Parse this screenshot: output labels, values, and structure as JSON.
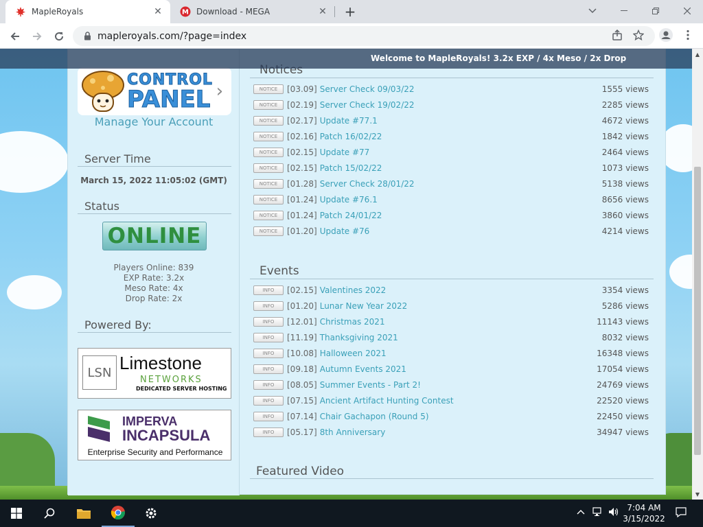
{
  "browser": {
    "tabs": [
      {
        "title": "MapleRoyals",
        "favicon": "maple-leaf-icon",
        "active": true
      },
      {
        "title": "Download - MEGA",
        "favicon": "mega-icon",
        "active": false
      }
    ],
    "url": "mapleroyals.com/?page=index"
  },
  "page": {
    "welcome": "Welcome to MapleRoyals! 3.2x EXP / 4x Meso / 2x Drop",
    "sidebar": {
      "cp_line1": "CONTROL",
      "cp_line2": "PANEL",
      "manage": "Manage Your Account",
      "server_time_heading": "Server Time",
      "server_time": "March 15, 2022 11:05:02 (GMT)",
      "status_heading": "Status",
      "status": "ONLINE",
      "players_online": "Players Online: 839",
      "exp_rate": "EXP Rate: 3.2x",
      "meso_rate": "Meso Rate: 4x",
      "drop_rate": "Drop Rate: 2x",
      "powered_heading": "Powered By:",
      "limestone": {
        "box": "LSN",
        "name": "Limestone",
        "sub": "NETWORKS",
        "tag": "DEDICATED SERVER HOSTING"
      },
      "imperva": {
        "name": "IMPERVA",
        "sub": "INCAPSULA",
        "tag": "Enterprise Security and Performance"
      }
    },
    "notices_heading": "Notices",
    "notices": [
      {
        "badge": "NOTICE",
        "date": "[03.09]",
        "title": "Server Check 09/03/22",
        "views": "1555 views"
      },
      {
        "badge": "NOTICE",
        "date": "[02.19]",
        "title": "Server Check 19/02/22",
        "views": "2285 views"
      },
      {
        "badge": "NOTICE",
        "date": "[02.17]",
        "title": "Update #77.1",
        "views": "4672 views"
      },
      {
        "badge": "NOTICE",
        "date": "[02.16]",
        "title": "Patch 16/02/22",
        "views": "1842 views"
      },
      {
        "badge": "NOTICE",
        "date": "[02.15]",
        "title": "Update #77",
        "views": "2464 views"
      },
      {
        "badge": "NOTICE",
        "date": "[02.15]",
        "title": "Patch 15/02/22",
        "views": "1073 views"
      },
      {
        "badge": "NOTICE",
        "date": "[01.28]",
        "title": "Server Check 28/01/22",
        "views": "5138 views"
      },
      {
        "badge": "NOTICE",
        "date": "[01.24]",
        "title": "Update #76.1",
        "views": "8656 views"
      },
      {
        "badge": "NOTICE",
        "date": "[01.24]",
        "title": "Patch 24/01/22",
        "views": "3860 views"
      },
      {
        "badge": "NOTICE",
        "date": "[01.20]",
        "title": "Update #76",
        "views": "4214 views"
      }
    ],
    "events_heading": "Events",
    "events": [
      {
        "badge": "INFO",
        "date": "[02.15]",
        "title": "Valentines 2022",
        "views": "3354 views"
      },
      {
        "badge": "INFO",
        "date": "[01.20]",
        "title": "Lunar New Year 2022",
        "views": "5286 views"
      },
      {
        "badge": "INFO",
        "date": "[12.01]",
        "title": "Christmas 2021",
        "views": "11143 views"
      },
      {
        "badge": "INFO",
        "date": "[11.19]",
        "title": "Thanksgiving 2021",
        "views": "8032 views"
      },
      {
        "badge": "INFO",
        "date": "[10.08]",
        "title": "Halloween 2021",
        "views": "16348 views"
      },
      {
        "badge": "INFO",
        "date": "[09.18]",
        "title": "Autumn Events 2021",
        "views": "17054 views"
      },
      {
        "badge": "INFO",
        "date": "[08.05]",
        "title": "Summer Events - Part 2!",
        "views": "24769 views"
      },
      {
        "badge": "INFO",
        "date": "[07.15]",
        "title": "Ancient Artifact Hunting Contest",
        "views": "22520 views"
      },
      {
        "badge": "INFO",
        "date": "[07.14]",
        "title": "Chair Gachapon (Round 5)",
        "views": "22450 views"
      },
      {
        "badge": "INFO",
        "date": "[05.17]",
        "title": "8th Anniversary",
        "views": "34947 views"
      }
    ],
    "featured_heading": "Featured Video"
  },
  "taskbar": {
    "time": "7:04 AM",
    "date": "3/15/2022"
  }
}
